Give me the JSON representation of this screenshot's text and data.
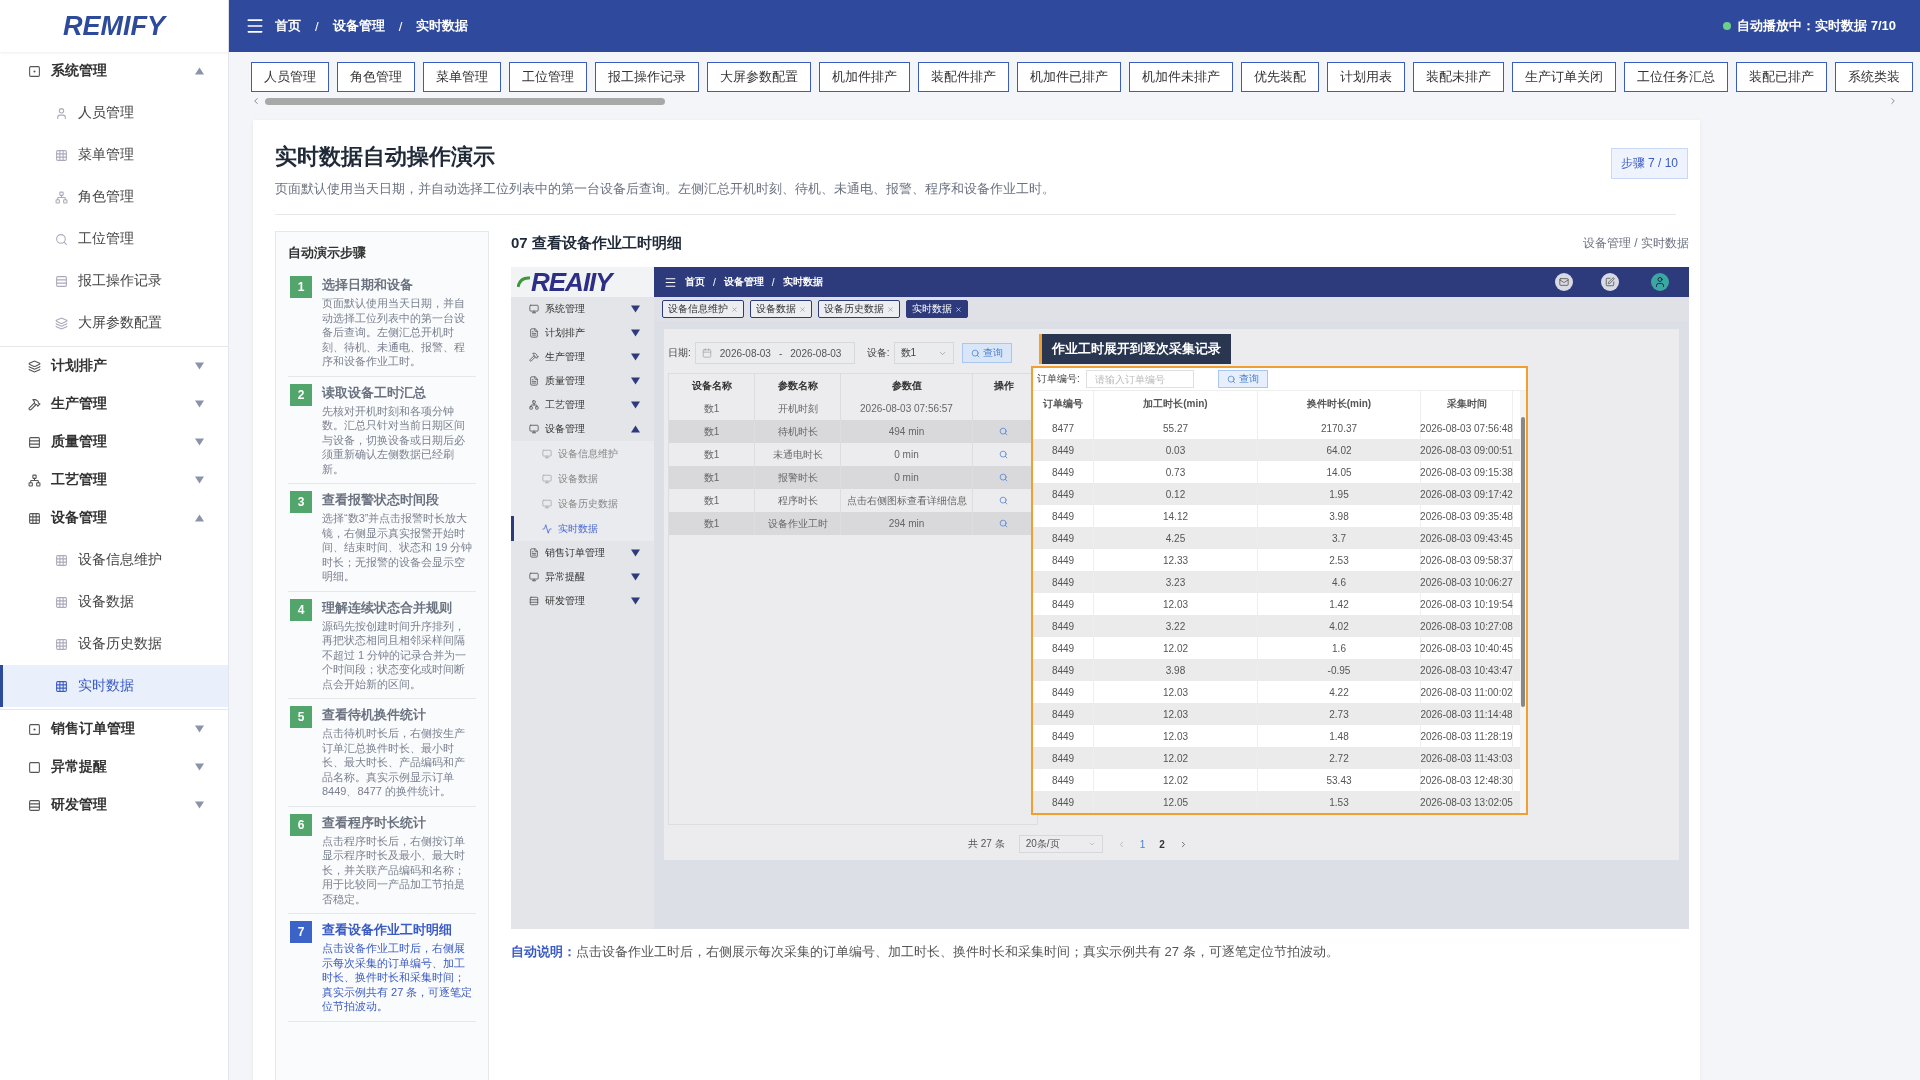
{
  "sidebar": {
    "logo": "REMIFY",
    "groups": [
      {
        "label": "系统管理",
        "expanded": true,
        "children": [
          {
            "label": "人员管理",
            "selected": false
          },
          {
            "label": "菜单管理",
            "selected": false
          },
          {
            "label": "角色管理",
            "selected": false
          },
          {
            "label": "工位管理",
            "selected": false
          },
          {
            "label": "报工操作记录",
            "selected": false
          },
          {
            "label": "大屏参数配置",
            "selected": false
          }
        ]
      },
      {
        "label": "计划排产",
        "expanded": false
      },
      {
        "label": "生产管理",
        "expanded": false
      },
      {
        "label": "质量管理",
        "expanded": false
      },
      {
        "label": "工艺管理",
        "expanded": false
      },
      {
        "label": "设备管理",
        "expanded": true,
        "children": [
          {
            "label": "设备信息维护",
            "selected": false
          },
          {
            "label": "设备数据",
            "selected": false
          },
          {
            "label": "设备历史数据",
            "selected": false
          },
          {
            "label": "实时数据",
            "selected": true
          }
        ]
      },
      {
        "label": "销售订单管理",
        "expanded": false
      },
      {
        "label": "异常提醒",
        "expanded": false
      },
      {
        "label": "研发管理",
        "expanded": false
      }
    ]
  },
  "header": {
    "breadcrumb": [
      "首页",
      "设备管理",
      "实时数据"
    ],
    "breadcrumb_separator": "/",
    "status": "自动播放中：实时数据 7/10"
  },
  "tabs": [
    "人员管理",
    "角色管理",
    "菜单管理",
    "工位管理",
    "报工操作记录",
    "大屏参数配置",
    "机加件排产",
    "装配件排产",
    "机加件已排产",
    "机加件未排产",
    "优先装配",
    "计划用表",
    "装配未排产",
    "生产订单关闭",
    "工位任务汇总",
    "装配已排产",
    "系统类装"
  ],
  "page": {
    "title": "实时数据自动操作演示",
    "description": "页面默认使用当天日期，并自动选择工位列表中的第一台设备后查询。左侧汇总开机时刻、待机、未通电、报警、程序和设备作业工时。",
    "step_badge": "步骤 7 / 10"
  },
  "steps": {
    "title": "自动演示步骤",
    "items": [
      {
        "number": "1",
        "title": "选择日期和设备",
        "text": "页面默认使用当天日期，并自动选择工位列表中的第一台设备后查询。左侧汇总开机时刻、待机、未通电、报警、程序和设备作业工时。",
        "selected": false
      },
      {
        "number": "2",
        "title": "读取设备工时汇总",
        "text": "先核对开机时刻和各项分钟数。汇总只针对当前日期区间与设备，切换设备或日期后必须重新确认左侧数据已经刷新。",
        "selected": false
      },
      {
        "number": "3",
        "title": "查看报警状态时间段",
        "text": "选择“数3”并点击报警时长放大镜，右侧显示真实报警开始时间、结束时间、状态和 19 分钟时长；无报警的设备会显示空明细。",
        "selected": false
      },
      {
        "number": "4",
        "title": "理解连续状态合并规则",
        "text": "源码先按创建时间升序排列，再把状态相同且相邻采样间隔不超过 1 分钟的记录合并为一个时间段；状态变化或时间断点会开始新的区间。",
        "selected": false
      },
      {
        "number": "5",
        "title": "查看待机换件统计",
        "text": "点击待机时长后，右侧按生产订单汇总换件时长、最小时长、最大时长、产品编码和产品名称。真实示例显示订单 8449、8477 的换件统计。",
        "selected": false
      },
      {
        "number": "6",
        "title": "查看程序时长统计",
        "text": "点击程序时长后，右侧按订单显示程序时长及最小、最大时长，并关联产品编码和名称；用于比较同一产品加工节拍是否稳定。",
        "selected": false
      },
      {
        "number": "7",
        "title": "查看设备作业工时明细",
        "text": "点击设备作业工时后，右侧展示每次采集的订单编号、加工时长、换件时长和采集时间；真实示例共有 27 条，可逐笔定位节拍波动。",
        "selected": true
      }
    ]
  },
  "detail": {
    "heading": "07 查看设备作业工时明细",
    "breadcrumb": "设备管理 / 实时数据"
  },
  "demo": {
    "logo": "REAIIY",
    "breadcrumb": [
      "首页",
      "设备管理",
      "实时数据"
    ],
    "breadcrumb_separator": "/",
    "tabs": [
      {
        "label": "设备信息维护",
        "selected": false
      },
      {
        "label": "设备数据",
        "selected": false
      },
      {
        "label": "设备历史数据",
        "selected": false
      },
      {
        "label": "实时数据",
        "selected": true
      }
    ],
    "menu": [
      {
        "label": "系统管理",
        "expanded": false
      },
      {
        "label": "计划排产",
        "expanded": false
      },
      {
        "label": "生产管理",
        "expanded": false
      },
      {
        "label": "质量管理",
        "expanded": false
      },
      {
        "label": "工艺管理",
        "expanded": false
      },
      {
        "label": "设备管理",
        "expanded": true,
        "children": [
          {
            "label": "设备信息维护",
            "selected": false
          },
          {
            "label": "设备数据",
            "selected": false
          },
          {
            "label": "设备历史数据",
            "selected": false
          },
          {
            "label": "实时数据",
            "selected": true
          }
        ]
      },
      {
        "label": "销售订单管理",
        "expanded": false
      },
      {
        "label": "异常提醒",
        "expanded": false
      },
      {
        "label": "研发管理",
        "expanded": false
      }
    ],
    "filter": {
      "date_label": "日期:",
      "date_from": "2026-08-03",
      "separator": "-",
      "date_to": "2026-08-03",
      "device_label": "设备:",
      "device_value": "数1",
      "query": "查询"
    },
    "table": {
      "columns": [
        "设备名称",
        "参数名称",
        "参数值",
        "操作"
      ],
      "rows": [
        {
          "cells": [
            "数1",
            "开机时刻",
            "2026-08-03 07:56:57"
          ],
          "action": false
        },
        {
          "cells": [
            "数1",
            "待机时长",
            "494 min"
          ],
          "action": true
        },
        {
          "cells": [
            "数1",
            "未通电时长",
            "0 min"
          ],
          "action": true
        },
        {
          "cells": [
            "数1",
            "报警时长",
            "0 min"
          ],
          "action": true
        },
        {
          "cells": [
            "数1",
            "程序时长",
            "点击右侧图标查看详细信息"
          ],
          "action": true
        },
        {
          "cells": [
            "数1",
            "设备作业工时",
            "294 min"
          ],
          "action": true
        }
      ]
    },
    "popup": {
      "label": "作业工时展开到逐次采集记录",
      "search_label": "订单编号:",
      "placeholder": "请输入订单编号",
      "query": "查询",
      "columns": [
        "订单编号",
        "加工时长(min)",
        "换件时长(min)",
        "采集时间"
      ],
      "rows": [
        [
          "8477",
          "55.27",
          "2170.37",
          "2026-08-03 07:56:48"
        ],
        [
          "8449",
          "0.03",
          "64.02",
          "2026-08-03 09:00:51"
        ],
        [
          "8449",
          "0.73",
          "14.05",
          "2026-08-03 09:15:38"
        ],
        [
          "8449",
          "0.12",
          "1.95",
          "2026-08-03 09:17:42"
        ],
        [
          "8449",
          "14.12",
          "3.98",
          "2026-08-03 09:35:48"
        ],
        [
          "8449",
          "4.25",
          "3.7",
          "2026-08-03 09:43:45"
        ],
        [
          "8449",
          "12.33",
          "2.53",
          "2026-08-03 09:58:37"
        ],
        [
          "8449",
          "3.23",
          "4.6",
          "2026-08-03 10:06:27"
        ],
        [
          "8449",
          "12.03",
          "1.42",
          "2026-08-03 10:19:54"
        ],
        [
          "8449",
          "3.22",
          "4.02",
          "2026-08-03 10:27:08"
        ],
        [
          "8449",
          "12.02",
          "1.6",
          "2026-08-03 10:40:45"
        ],
        [
          "8449",
          "3.98",
          "-0.95",
          "2026-08-03 10:43:47"
        ],
        [
          "8449",
          "12.03",
          "4.22",
          "2026-08-03 11:00:02"
        ],
        [
          "8449",
          "12.03",
          "2.73",
          "2026-08-03 11:14:48"
        ],
        [
          "8449",
          "12.03",
          "1.48",
          "2026-08-03 11:28:19"
        ],
        [
          "8449",
          "12.02",
          "2.72",
          "2026-08-03 11:43:03"
        ],
        [
          "8449",
          "12.02",
          "53.43",
          "2026-08-03 12:48:30"
        ],
        [
          "8449",
          "12.05",
          "1.53",
          "2026-08-03 13:02:05"
        ]
      ]
    },
    "pagination": {
      "total": "共 27 条",
      "page_size": "20条/页",
      "pages": [
        {
          "label": "1",
          "selected": true
        },
        {
          "label": "2",
          "selected": false
        }
      ]
    }
  },
  "caption": {
    "label": "自动说明：",
    "text": "点击设备作业工时后，右侧展示每次采集的订单编号、加工时长、换件时长和采集时间；真实示例共有 27 条，可逐笔定位节拍波动。"
  }
}
